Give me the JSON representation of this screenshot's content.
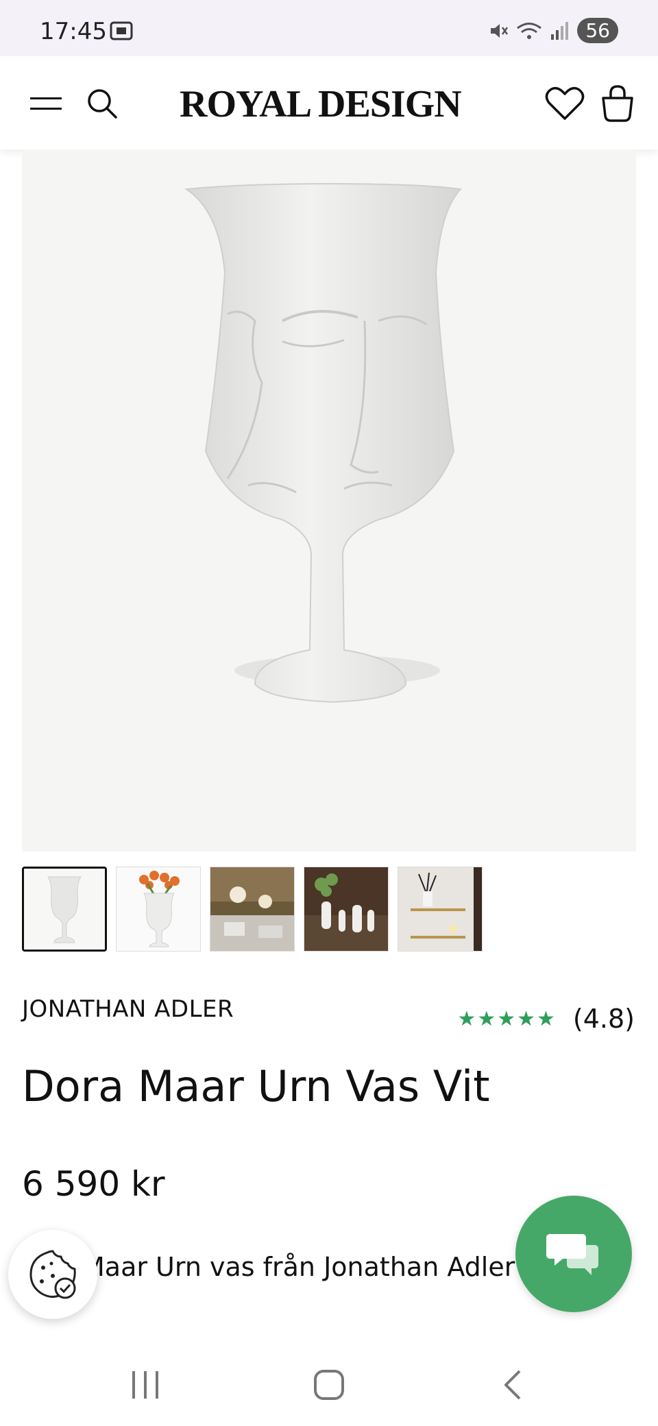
{
  "status_bar": {
    "time": "17:45",
    "battery": "56"
  },
  "header": {
    "logo": "ROYAL DESIGN"
  },
  "product": {
    "brand": "JONATHAN ADLER",
    "stars": "★★★★★",
    "rating": "(4.8)",
    "title": "Dora Maar Urn Vas Vit",
    "price": "6 590 kr",
    "description_snippet": "Maar Urn vas från Jonathan Adler i"
  },
  "icons": {
    "menu": "hamburger-icon",
    "search": "search-icon",
    "wishlist": "heart-icon",
    "cart": "bag-icon",
    "cookie": "cookie-icon",
    "chat": "chat-icon"
  },
  "colors": {
    "accent_green": "#46a868",
    "star_green": "#2e9e5b"
  }
}
